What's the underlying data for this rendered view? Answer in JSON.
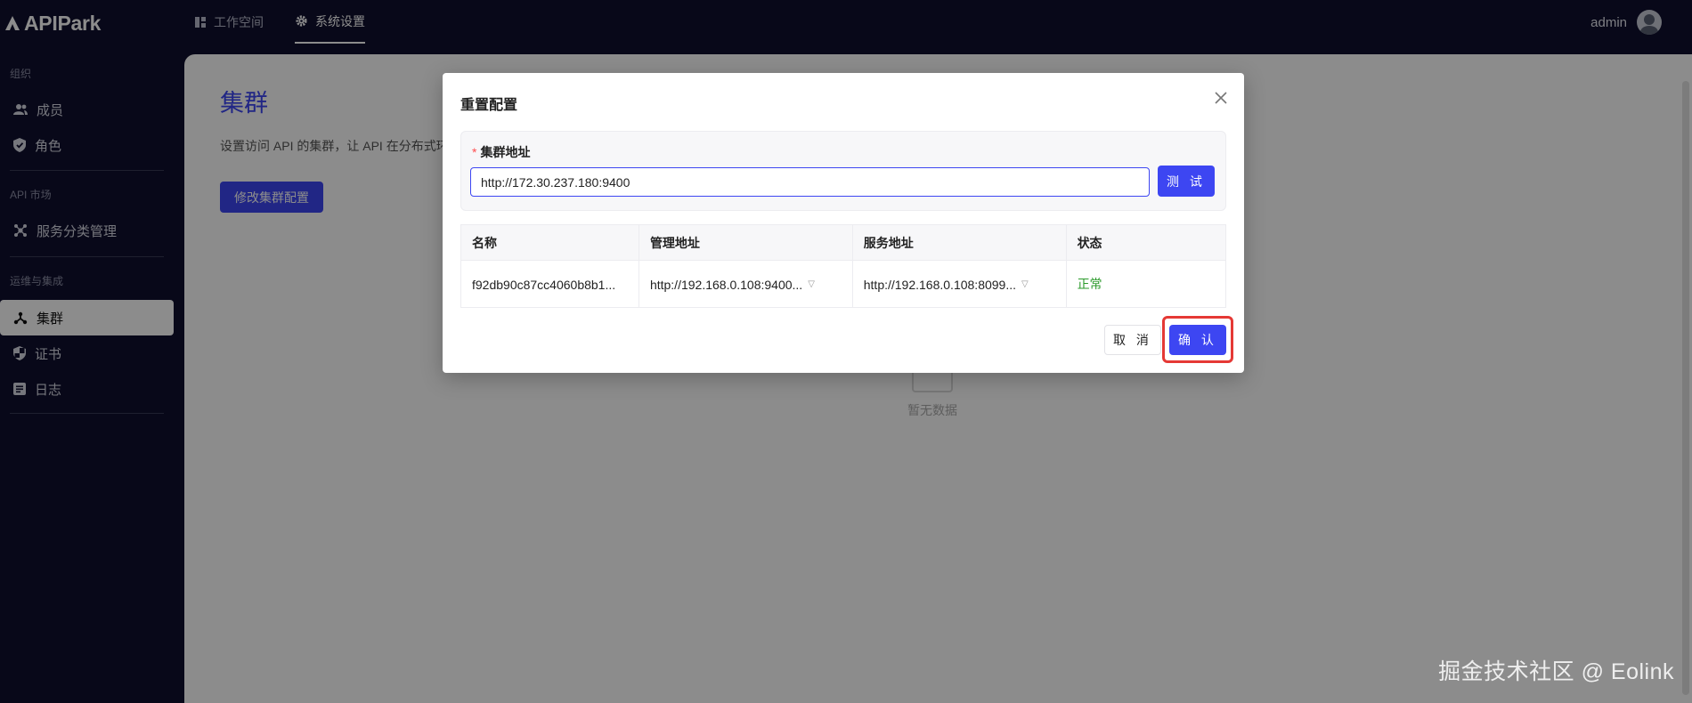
{
  "header": {
    "logo_text": "APIPark",
    "tabs": [
      {
        "label": "工作空间",
        "icon": "dashboard-icon"
      },
      {
        "label": "系统设置",
        "icon": "gear-icon",
        "active": true
      }
    ],
    "user": {
      "name": "admin"
    }
  },
  "sidebar": {
    "sections": [
      {
        "title": "组织",
        "items": [
          {
            "label": "成员",
            "icon": "members-icon"
          },
          {
            "label": "角色",
            "icon": "shield-check-icon"
          }
        ]
      },
      {
        "title": "API 市场",
        "items": [
          {
            "label": "服务分类管理",
            "icon": "category-icon"
          }
        ]
      },
      {
        "title": "运维与集成",
        "items": [
          {
            "label": "集群",
            "icon": "cluster-icon",
            "active": true
          },
          {
            "label": "证书",
            "icon": "certificate-icon"
          },
          {
            "label": "日志",
            "icon": "log-icon"
          }
        ]
      }
    ]
  },
  "main": {
    "title": "集群",
    "description": "设置访问 API 的集群，让 API 在分布式环",
    "edit_button": "修改集群配置",
    "empty_text": "暂无数据"
  },
  "modal": {
    "title": "重置配置",
    "field_required_mark": "*",
    "field_label": "集群地址",
    "field_value": "http://172.30.237.180:9400",
    "test_button": "测 试",
    "table": {
      "headers": [
        "名称",
        "管理地址",
        "服务地址",
        "状态"
      ],
      "rows": [
        {
          "name": "f92db90c87cc4060b8b1...",
          "admin_address": "http://192.168.0.108:9400...",
          "service_address": "http://192.168.0.108:8099...",
          "status": "正常"
        }
      ]
    },
    "cancel_button": "取 消",
    "confirm_button": "确 认"
  },
  "watermark": "掘金技术社区 @ Eolink",
  "colors": {
    "nav_bg": "#0f0f2e",
    "accent": "#3d46f2",
    "status_ok": "#2b9a2b",
    "highlight": "#e53935"
  }
}
